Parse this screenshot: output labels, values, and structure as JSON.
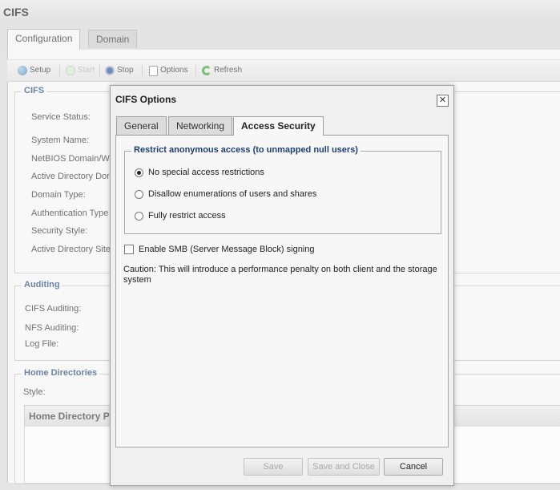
{
  "app": {
    "title": "CIFS"
  },
  "page_tabs": [
    {
      "label": "Configuration",
      "active": true
    },
    {
      "label": "Domain",
      "active": false
    }
  ],
  "toolbar": {
    "setup": "Setup",
    "start": "Start",
    "stop": "Stop",
    "options": "Options",
    "refresh": "Refresh"
  },
  "cifs_section": {
    "legend": "CIFS",
    "fields": [
      "Service Status:",
      "System Name:",
      "NetBIOS Domain/W",
      "Active Directory Dor",
      "Domain Type:",
      "Authentication Type",
      "Security Style:",
      "Active Directory Site"
    ]
  },
  "auditing_section": {
    "legend": "Auditing",
    "fields": [
      "CIFS Auditing:",
      "NFS Auditing:",
      "Log File:"
    ]
  },
  "home_section": {
    "legend": "Home Directories",
    "style_label": "Style:",
    "grid_header": "Home Directory P"
  },
  "dialog": {
    "title": "CIFS Options",
    "close_glyph": "✕",
    "tabs": [
      {
        "label": "General",
        "active": false
      },
      {
        "label": "Networking",
        "active": false
      },
      {
        "label": "Access Security",
        "active": true
      }
    ],
    "restrict": {
      "legend": "Restrict anonymous access (to unmapped null users)",
      "options": [
        {
          "label": "No special access restrictions",
          "selected": true
        },
        {
          "label": "Disallow enumerations of users and shares",
          "selected": false
        },
        {
          "label": "Fully restrict access",
          "selected": false
        }
      ]
    },
    "smb_signing": {
      "label": "Enable SMB (Server Message Block) signing",
      "checked": false
    },
    "caution": "Caution: This will introduce a performance penalty on both client and the storage system",
    "buttons": {
      "save": "Save",
      "save_close": "Save and Close",
      "cancel": "Cancel"
    }
  },
  "colors": {
    "legend_blue": "#1e3f74",
    "refresh_green": "#3a9a3a",
    "stop_blue": "#2a4f9a"
  }
}
